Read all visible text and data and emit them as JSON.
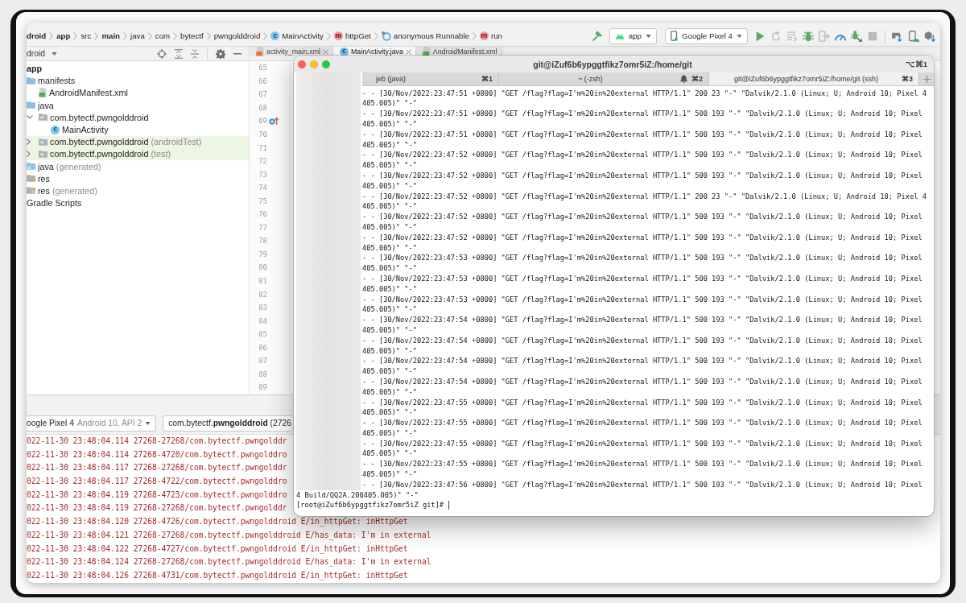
{
  "ide": {
    "breadcrumb": [
      {
        "label": "droid",
        "bold": true
      },
      {
        "label": "app",
        "bold": true
      },
      {
        "label": "src",
        "bold": false
      },
      {
        "label": "main",
        "bold": true
      },
      {
        "label": "java",
        "bold": false
      },
      {
        "label": "com",
        "bold": false
      },
      {
        "label": "bytectf",
        "bold": false
      },
      {
        "label": "pwngolddroid",
        "bold": false
      },
      {
        "label": "MainActivity",
        "bold": false,
        "kind": "class",
        "icon_text": "c"
      },
      {
        "label": "httpGet",
        "bold": false,
        "kind": "method",
        "icon_text": "m"
      },
      {
        "label": "anonymous Runnable",
        "bold": false,
        "kind": "lambda"
      },
      {
        "label": "run",
        "bold": false,
        "kind": "method",
        "icon_text": "m"
      }
    ],
    "toolbar": [
      {
        "kind": "build",
        "disabled": false
      },
      {
        "kind": "config",
        "label": "app"
      },
      {
        "kind": "device",
        "label": "Google Pixel 4"
      },
      {
        "kind": "run",
        "disabled": false
      },
      {
        "kind": "apply_restart",
        "disabled": true
      },
      {
        "kind": "apply_changes",
        "disabled": true
      },
      {
        "kind": "debug",
        "disabled": false
      },
      {
        "kind": "profile",
        "disabled": true
      },
      {
        "kind": "profiler",
        "disabled": false
      },
      {
        "kind": "attach",
        "disabled": false
      },
      {
        "kind": "stop",
        "disabled": true
      },
      {
        "kind": "sync",
        "disabled": false
      },
      {
        "kind": "device_manager",
        "disabled": false
      },
      {
        "kind": "sdk_manager",
        "disabled": false
      }
    ],
    "project": {
      "view": "droid",
      "tree": [
        {
          "label": "app",
          "bold": true,
          "children": [
            {
              "label": "manifests",
              "kind": "folder",
              "children": [
                {
                  "label": "AndroidManifest.xml",
                  "kind": "manifest"
                }
              ]
            },
            {
              "label": "java",
              "kind": "folder",
              "children": [
                {
                  "label": "com.bytectf.pwngolddroid",
                  "kind": "package",
                  "expanded": true,
                  "highlighted": false,
                  "children": [
                    {
                      "label": "MainActivity",
                      "kind": "class",
                      "icon_text": "c"
                    }
                  ]
                },
                {
                  "label": "com.bytectf.pwngolddroid",
                  "suffix": "(androidTest)",
                  "kind": "package",
                  "expanded": false,
                  "highlighted": true
                },
                {
                  "label": "com.bytectf.pwngolddroid",
                  "suffix": "(test)",
                  "kind": "package",
                  "expanded": false,
                  "highlighted": true
                }
              ]
            },
            {
              "label": "java",
              "suffix": "(generated)",
              "kind": "generated"
            },
            {
              "label": "res",
              "kind": "res"
            },
            {
              "label": "res",
              "suffix": "(generated)",
              "kind": "res_generated"
            }
          ]
        },
        {
          "label": "Gradle Scripts",
          "bold": false
        }
      ]
    },
    "editor_tabs": [
      {
        "label": "activity_main.xml",
        "kind": "layout",
        "selected": false,
        "closable": true
      },
      {
        "label": "MainActivity.java",
        "kind": "class",
        "icon_text": "c",
        "selected": true,
        "closable": true
      },
      {
        "label": "AndroidManifest.xml",
        "kind": "manifest",
        "selected": false,
        "closable": false
      }
    ],
    "gutter": [
      {
        "number": "65",
        "marker": false
      },
      {
        "number": "66",
        "marker": false
      },
      {
        "number": "67",
        "marker": false
      },
      {
        "number": "68",
        "marker": false
      },
      {
        "number": "69",
        "marker": true
      },
      {
        "number": "70",
        "marker": false
      },
      {
        "number": "71",
        "marker": false
      },
      {
        "number": "72",
        "marker": false
      },
      {
        "number": "73",
        "marker": false
      },
      {
        "number": "74",
        "marker": false
      },
      {
        "number": "75",
        "marker": false
      },
      {
        "number": "76",
        "marker": false
      },
      {
        "number": "77",
        "marker": false
      },
      {
        "number": "78",
        "marker": false
      },
      {
        "number": "79",
        "marker": false
      },
      {
        "number": "80",
        "marker": false
      },
      {
        "number": "81",
        "marker": false
      },
      {
        "number": "82",
        "marker": false
      },
      {
        "number": "83",
        "marker": false
      },
      {
        "number": "84",
        "marker": false
      },
      {
        "number": "85",
        "marker": false
      },
      {
        "number": "86",
        "marker": false
      },
      {
        "number": "87",
        "marker": false
      },
      {
        "number": "88",
        "marker": false
      },
      {
        "number": "89",
        "marker": false
      }
    ],
    "logcat": {
      "device": "oogle Pixel 4",
      "device_detail": "Android 10, API 2",
      "process": "com.bytectf.**pwngolddroid** (2726",
      "lines": [
        "022-11-30 23:48:04.114 27268-27268/com.bytectf.pwngolddr",
        "022-11-30 23:48:04.114 27268-4720/com.bytectf.pwngolddro",
        "022-11-30 23:48:04.117 27268-27268/com.bytectf.pwngolddr",
        "022-11-30 23:48:04.117 27268-4722/com.bytectf.pwngolddro",
        "022-11-30 23:48:04.119 27268-4723/com.bytectf.pwngolddro",
        "022-11-30 23:48:04.119 27268-27268/com.bytectf.pwngolddr",
        "022-11-30 23:48:04.120 27268-4726/com.bytectf.pwngolddroid E/in_httpGet: inHttpGet",
        "022-11-30 23:48:04.121 27268-27268/com.bytectf.pwngolddroid E/has_data: I'm in external",
        "022-11-30 23:48:04.122 27268-4727/com.bytectf.pwngolddroid E/in_httpGet: inHttpGet",
        "022-11-30 23:48:04.124 27268-27268/com.bytectf.pwngolddroid E/has_data: I'm in external",
        "022-11-30 23:48:04.126 27268-4731/com.bytectf.pwngolddroid E/in_httpGet: inHttpGet"
      ]
    }
  },
  "terminal": {
    "title": "git@iZuf6b6ypggtfikz7omr5iZ:/home/git",
    "shortcut": "⌥⌘1",
    "tabs": [
      {
        "label": "jeb (java)",
        "shortcut": "⌘1",
        "selected": false,
        "bell": false
      },
      {
        "label": "~ (-zsh)",
        "shortcut": "⌘2",
        "selected": false,
        "bell": true
      },
      {
        "label": "git@iZuf6b6ypggtfikz7omr5iZ:/home/git (ssh)",
        "shortcut": "⌘3",
        "selected": true,
        "bell": false
      }
    ],
    "lines": [
      "- - [30/Nov/2022:23:47:51 +0800] \"GET /flag?flag=I'm%20in%20external HTTP/1.1\" 200 23 \"-\" \"Dalvik/2.1.0 (Linux; U; Android 10; Pixel 4",
      "405.005)\" \"-\"",
      "- - [30/Nov/2022:23:47:51 +0800] \"GET /flag?flag=I'm%20in%20external HTTP/1.1\" 500 193 \"-\" \"Dalvik/2.1.0 (Linux; U; Android 10; Pixel",
      "405.005)\" \"-\"",
      "- - [30/Nov/2022:23:47:51 +0800] \"GET /flag?flag=I'm%20in%20external HTTP/1.1\" 500 193 \"-\" \"Dalvik/2.1.0 (Linux; U; Android 10; Pixel",
      "405.005)\" \"-\"",
      "- - [30/Nov/2022:23:47:52 +0800] \"GET /flag?flag=I'm%20in%20external HTTP/1.1\" 500 193 \"-\" \"Dalvik/2.1.0 (Linux; U; Android 10; Pixel",
      "405.005)\" \"-\"",
      "- - [30/Nov/2022:23:47:52 +0800] \"GET /flag?flag=I'm%20in%20external HTTP/1.1\" 500 193 \"-\" \"Dalvik/2.1.0 (Linux; U; Android 10; Pixel",
      "405.005)\" \"-\"",
      "- - [30/Nov/2022:23:47:52 +0800] \"GET /flag?flag=I'm%20in%20external HTTP/1.1\" 200 23 \"-\" \"Dalvik/2.1.0 (Linux; U; Android 10; Pixel 4",
      "405.005)\" \"-\"",
      "- - [30/Nov/2022:23:47:52 +0800] \"GET /flag?flag=I'm%20in%20external HTTP/1.1\" 500 193 \"-\" \"Dalvik/2.1.0 (Linux; U; Android 10; Pixel",
      "405.005)\" \"-\"",
      "- - [30/Nov/2022:23:47:52 +0800] \"GET /flag?flag=I'm%20in%20external HTTP/1.1\" 500 193 \"-\" \"Dalvik/2.1.0 (Linux; U; Android 10; Pixel",
      "405.005)\" \"-\"",
      "- - [30/Nov/2022:23:47:53 +0800] \"GET /flag?flag=I'm%20in%20external HTTP/1.1\" 500 193 \"-\" \"Dalvik/2.1.0 (Linux; U; Android 10; Pixel",
      "405.005)\" \"-\"",
      "- - [30/Nov/2022:23:47:53 +0800] \"GET /flag?flag=I'm%20in%20external HTTP/1.1\" 500 193 \"-\" \"Dalvik/2.1.0 (Linux; U; Android 10; Pixel",
      "405.005)\" \"-\"",
      "- - [30/Nov/2022:23:47:53 +0800] \"GET /flag?flag=I'm%20in%20external HTTP/1.1\" 500 193 \"-\" \"Dalvik/2.1.0 (Linux; U; Android 10; Pixel",
      "405.005)\" \"-\"",
      "- - [30/Nov/2022:23:47:54 +0800] \"GET /flag?flag=I'm%20in%20external HTTP/1.1\" 500 193 \"-\" \"Dalvik/2.1.0 (Linux; U; Android 10; Pixel",
      "405.005)\" \"-\"",
      "- - [30/Nov/2022:23:47:54 +0800] \"GET /flag?flag=I'm%20in%20external HTTP/1.1\" 500 193 \"-\" \"Dalvik/2.1.0 (Linux; U; Android 10; Pixel",
      "405.005)\" \"-\"",
      "- - [30/Nov/2022:23:47:54 +0800] \"GET /flag?flag=I'm%20in%20external HTTP/1.1\" 500 193 \"-\" \"Dalvik/2.1.0 (Linux; U; Android 10; Pixel",
      "405.005)\" \"-\"",
      "- - [30/Nov/2022:23:47:54 +0800] \"GET /flag?flag=I'm%20in%20external HTTP/1.1\" 500 193 \"-\" \"Dalvik/2.1.0 (Linux; U; Android 10; Pixel",
      "405.005)\" \"-\"",
      "- - [30/Nov/2022:23:47:55 +0800] \"GET /flag?flag=I'm%20in%20external HTTP/1.1\" 500 193 \"-\" \"Dalvik/2.1.0 (Linux; U; Android 10; Pixel",
      "405.005)\" \"-\"",
      "- - [30/Nov/2022:23:47:55 +0800] \"GET /flag?flag=I'm%20in%20external HTTP/1.1\" 500 193 \"-\" \"Dalvik/2.1.0 (Linux; U; Android 10; Pixel",
      "405.005)\" \"-\"",
      "- - [30/Nov/2022:23:47:55 +0800] \"GET /flag?flag=I'm%20in%20external HTTP/1.1\" 500 193 \"-\" \"Dalvik/2.1.0 (Linux; U; Android 10; Pixel",
      "405.005)\" \"-\"",
      "- - [30/Nov/2022:23:47:55 +0800] \"GET /flag?flag=I'm%20in%20external HTTP/1.1\" 500 193 \"-\" \"Dalvik/2.1.0 (Linux; U; Android 10; Pixel",
      "405.005)\" \"-\"",
      "- - [30/Nov/2022:23:47:56 +0800] \"GET /flag?flag=I'm%20in%20external HTTP/1.1\" 500 193 \"-\" \"Dalvik/2.1.0 (Linux; U; Android 10; Pixel"
    ],
    "tail": [
      "4 Build/QQ2A.200405.005)\" \"-\""
    ],
    "prompt": "[root@iZuf6b6ypggtfikz7omr5iZ git]#"
  }
}
